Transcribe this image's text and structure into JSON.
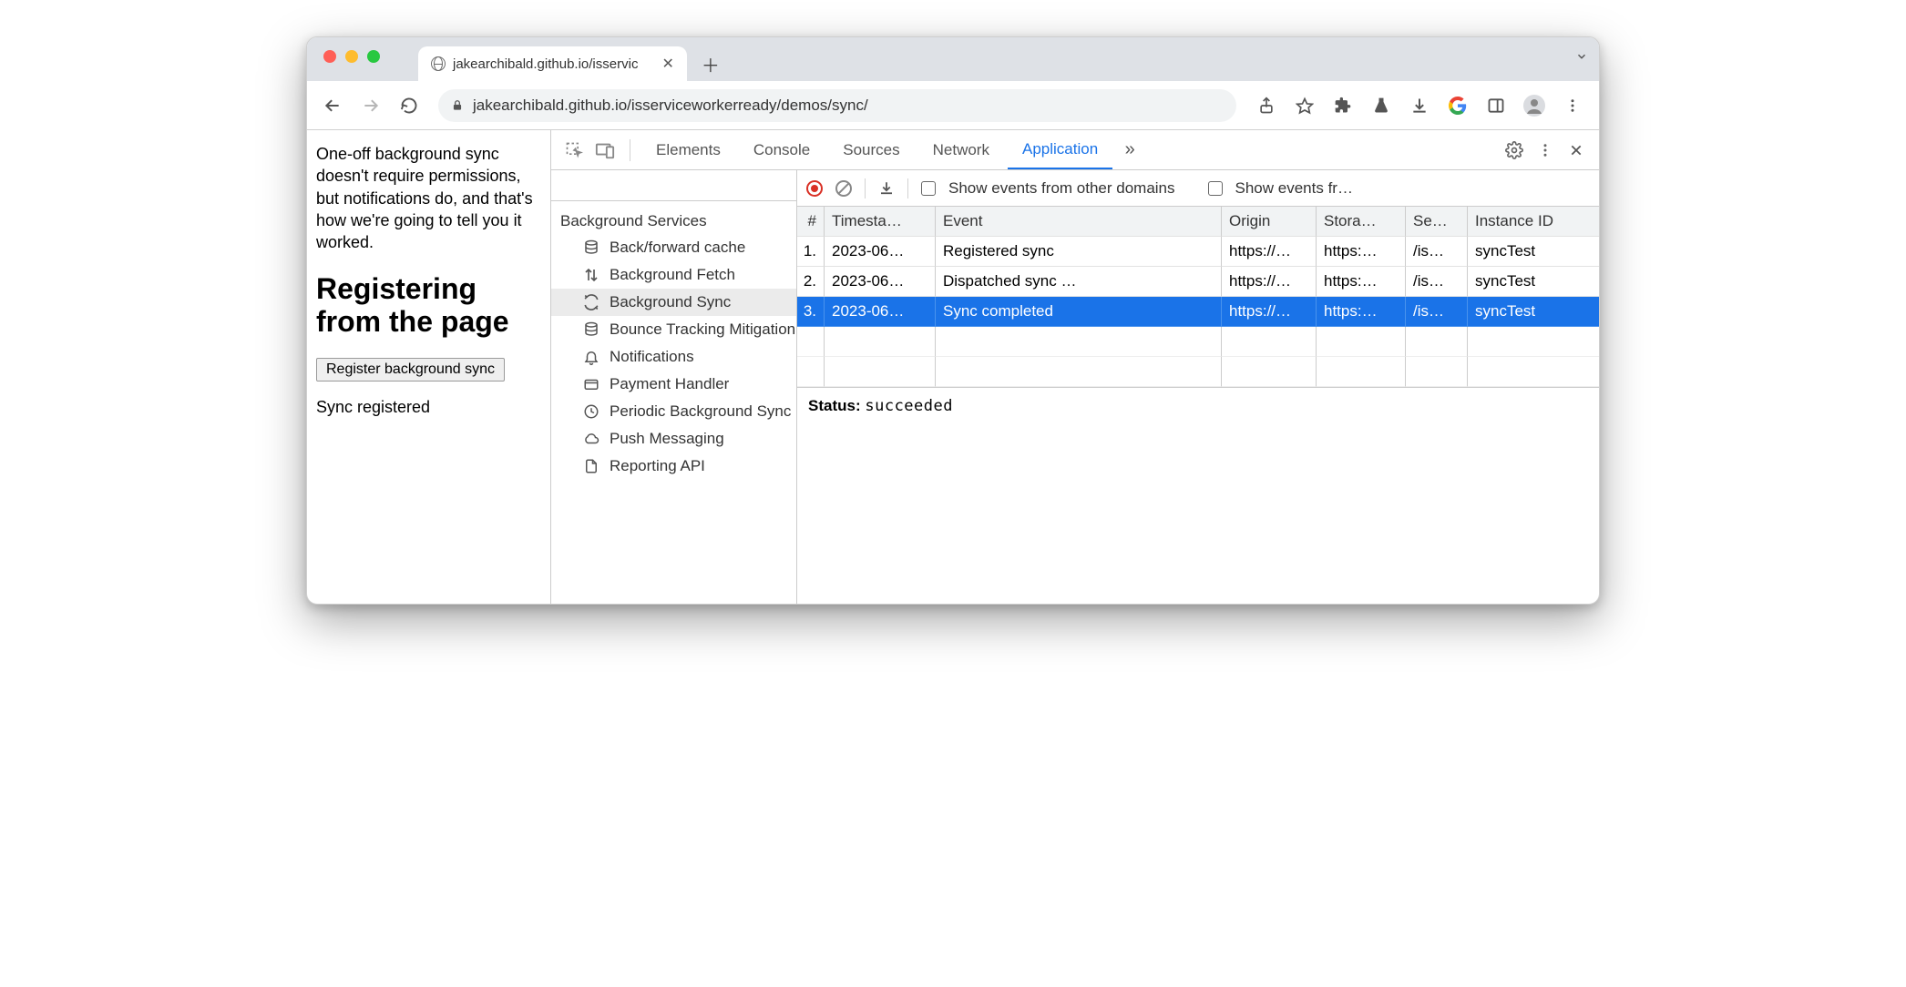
{
  "tab": {
    "title": "jakearchibald.github.io/isservic"
  },
  "address": {
    "url_display": "jakearchibald.github.io/isserviceworkerready/demos/sync/"
  },
  "page": {
    "paragraph": "One-off background sync doesn't require permissions, but notifications do, and that's how we're going to tell you it worked.",
    "heading": "Registering from the page",
    "button_label": "Register background sync",
    "status_text": "Sync registered"
  },
  "devtools": {
    "tabs": {
      "elements": "Elements",
      "console": "Console",
      "sources": "Sources",
      "network": "Network",
      "application": "Application"
    },
    "sidebar": {
      "heading": "Background Services",
      "items": [
        {
          "label": "Back/forward cache",
          "icon": "database",
          "selected": false
        },
        {
          "label": "Background Fetch",
          "icon": "updown",
          "selected": false
        },
        {
          "label": "Background Sync",
          "icon": "sync",
          "selected": true
        },
        {
          "label": "Bounce Tracking Mitigation",
          "icon": "database",
          "selected": false
        },
        {
          "label": "Notifications",
          "icon": "bell",
          "selected": false
        },
        {
          "label": "Payment Handler",
          "icon": "card",
          "selected": false
        },
        {
          "label": "Periodic Background Sync",
          "icon": "clock",
          "selected": false
        },
        {
          "label": "Push Messaging",
          "icon": "cloud",
          "selected": false
        },
        {
          "label": "Reporting API",
          "icon": "file",
          "selected": false
        }
      ]
    },
    "toolbar2": {
      "chk1_label": "Show events from other domains",
      "chk2_label": "Show events fr…"
    },
    "grid": {
      "headers": {
        "num": "#",
        "ts": "Timesta…",
        "ev": "Event",
        "or": "Origin",
        "st": "Stora…",
        "se": "Se…",
        "id": "Instance ID"
      },
      "rows": [
        {
          "num": "1.",
          "ts": "2023-06…",
          "ev": "Registered sync",
          "or": "https://…",
          "st": "https:…",
          "se": "/is…",
          "id": "syncTest",
          "selected": false
        },
        {
          "num": "2.",
          "ts": "2023-06…",
          "ev": "Dispatched sync …",
          "or": "https://…",
          "st": "https:…",
          "se": "/is…",
          "id": "syncTest",
          "selected": false
        },
        {
          "num": "3.",
          "ts": "2023-06…",
          "ev": "Sync completed",
          "or": "https://…",
          "st": "https:…",
          "se": "/is…",
          "id": "syncTest",
          "selected": true
        }
      ]
    },
    "status": {
      "label": "Status:",
      "value": "succeeded"
    }
  }
}
